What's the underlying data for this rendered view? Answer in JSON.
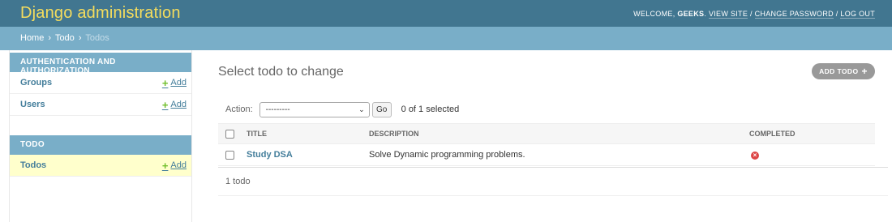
{
  "header": {
    "site_name": "Django administration",
    "welcome": "Welcome,",
    "username": "geeks",
    "view_site": "View site",
    "change_password": "Change password",
    "log_out": "Log out",
    "separator": "/"
  },
  "breadcrumbs": {
    "home": "Home",
    "app": "Todo",
    "current": "Todos",
    "sep": "›"
  },
  "sidebar": {
    "modules": [
      {
        "caption": "Authentication and Authorization",
        "items": [
          {
            "label": "Groups",
            "add": "Add"
          },
          {
            "label": "Users",
            "add": "Add"
          }
        ]
      },
      {
        "caption": "Todo",
        "items": [
          {
            "label": "Todos",
            "add": "Add"
          }
        ]
      }
    ]
  },
  "content": {
    "title": "Select todo to change",
    "add_button": "Add todo",
    "actions": {
      "label": "Action:",
      "selected_value": "---------",
      "go": "Go",
      "selection_count": "0 of 1 selected"
    },
    "table": {
      "columns": [
        "Title",
        "Description",
        "Completed"
      ],
      "rows": [
        {
          "title": "Study DSA",
          "description": "Solve Dynamic programming problems.",
          "completed": false
        }
      ]
    },
    "paginator": "1 todo"
  },
  "colors": {
    "header_bg": "#417690",
    "brand": "#f5dd5d",
    "breadcrumb_bg": "#79aec8",
    "link": "#447e9b",
    "add_green": "#70bf2b",
    "false_red": "#dd4646",
    "selected_row": "#ffffcc"
  }
}
